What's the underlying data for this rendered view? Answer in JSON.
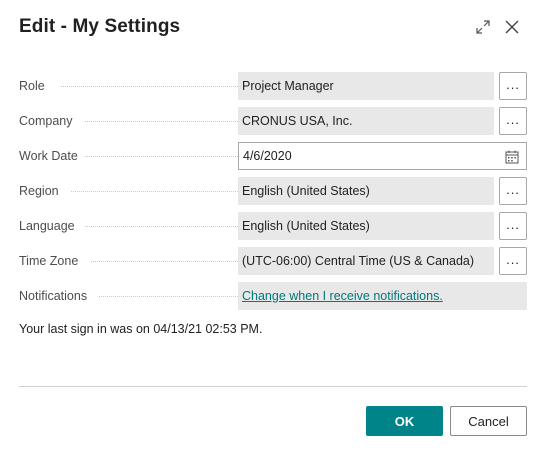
{
  "dialog": {
    "title": "Edit - My Settings",
    "expand_icon": "expand-arrows-icon",
    "close_icon": "close-icon"
  },
  "fields": {
    "role": {
      "label": "Role",
      "value": "Project Manager"
    },
    "company": {
      "label": "Company",
      "value": "CRONUS USA, Inc."
    },
    "work_date": {
      "label": "Work Date",
      "value": "4/6/2020"
    },
    "region": {
      "label": "Region",
      "value": "English (United States)"
    },
    "language": {
      "label": "Language",
      "value": "English (United States)"
    },
    "time_zone": {
      "label": "Time Zone",
      "value": "(UTC-06:00) Central Time (US & Canada)"
    },
    "notifications": {
      "label": "Notifications",
      "value": "Change when I receive notifications."
    }
  },
  "lookup_button_label": "...",
  "last_signin": "Your last sign in was on 04/13/21 02:53 PM.",
  "buttons": {
    "ok": "OK",
    "cancel": "Cancel"
  },
  "colors": {
    "accent": "#008489",
    "link": "#00787a",
    "field_bg": "#e8e8e8"
  }
}
